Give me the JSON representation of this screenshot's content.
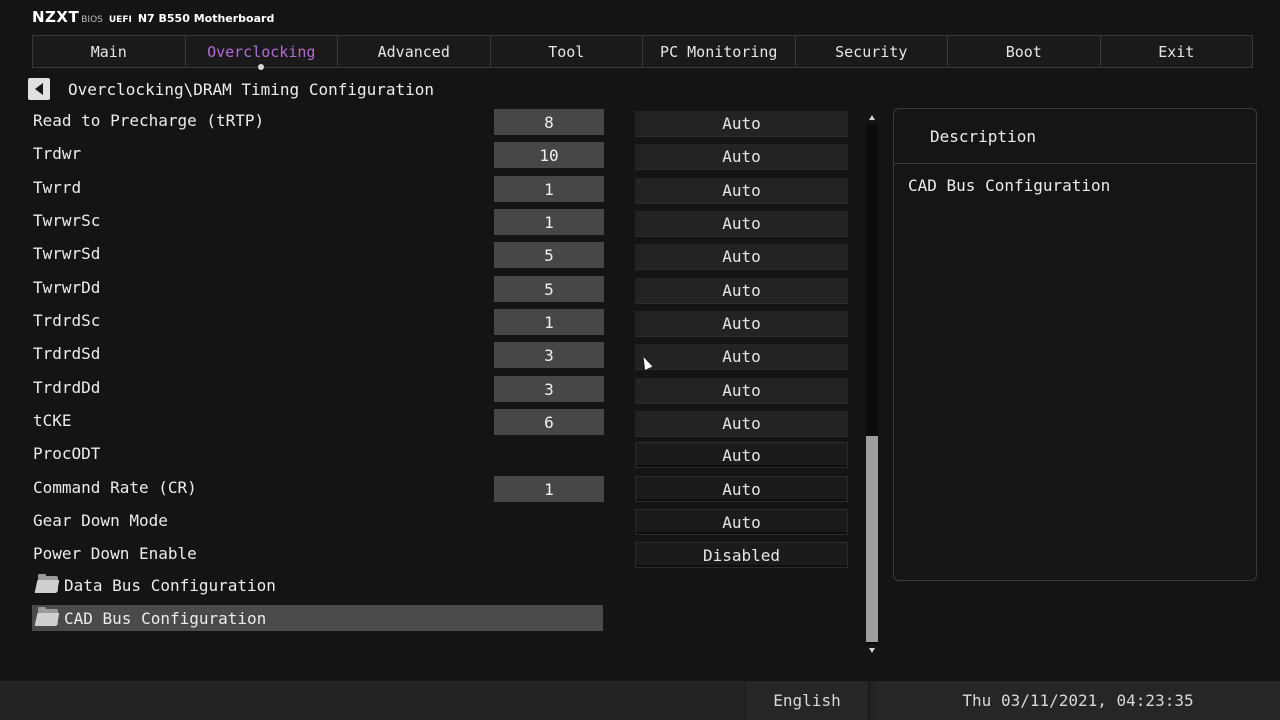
{
  "brand": {
    "logo": "NZXT",
    "bios": "BIOS",
    "uefi": "UEFI",
    "model": "N7 B550 Motherboard"
  },
  "tabs": [
    {
      "label": "Main"
    },
    {
      "label": "Overclocking",
      "active": true
    },
    {
      "label": "Advanced"
    },
    {
      "label": "Tool"
    },
    {
      "label": "PC Monitoring"
    },
    {
      "label": "Security"
    },
    {
      "label": "Boot"
    },
    {
      "label": "Exit"
    }
  ],
  "breadcrumb": {
    "path": "Overclocking\\DRAM Timing Configuration",
    "back_icon": "left-arrow-icon"
  },
  "settings": [
    {
      "label": "Read to Precharge (tRTP)",
      "value": "8",
      "option": "Auto"
    },
    {
      "label": "Trdwr",
      "value": "10",
      "option": "Auto"
    },
    {
      "label": "Twrrd",
      "value": "1",
      "option": "Auto"
    },
    {
      "label": "TwrwrSc",
      "value": "1",
      "option": "Auto"
    },
    {
      "label": "TwrwrSd",
      "value": "5",
      "option": "Auto"
    },
    {
      "label": "TwrwrDd",
      "value": "5",
      "option": "Auto"
    },
    {
      "label": "TrdrdSc",
      "value": "1",
      "option": "Auto"
    },
    {
      "label": "TrdrdSd",
      "value": "3",
      "option": "Auto"
    },
    {
      "label": "TrdrdDd",
      "value": "3",
      "option": "Auto"
    },
    {
      "label": "tCKE",
      "value": "6",
      "option": "Auto"
    },
    {
      "label": "ProcODT",
      "value": null,
      "option": "Auto"
    },
    {
      "label": "Command Rate (CR)",
      "value": "1",
      "option": "Auto"
    },
    {
      "label": "Gear Down Mode",
      "value": null,
      "option": "Auto"
    },
    {
      "label": "Power Down Enable",
      "value": null,
      "option": "Disabled"
    }
  ],
  "folders": [
    {
      "label": "Data Bus Configuration",
      "icon": "folder-icon"
    },
    {
      "label": "CAD Bus Configuration",
      "icon": "folder-icon",
      "selected": true
    }
  ],
  "scrollbar": {
    "position_fraction": 0.62
  },
  "description": {
    "title": "Description",
    "text": "CAD Bus Configuration"
  },
  "footer": {
    "language": "English",
    "datetime": "Thu 03/11/2021, 04:23:35"
  }
}
